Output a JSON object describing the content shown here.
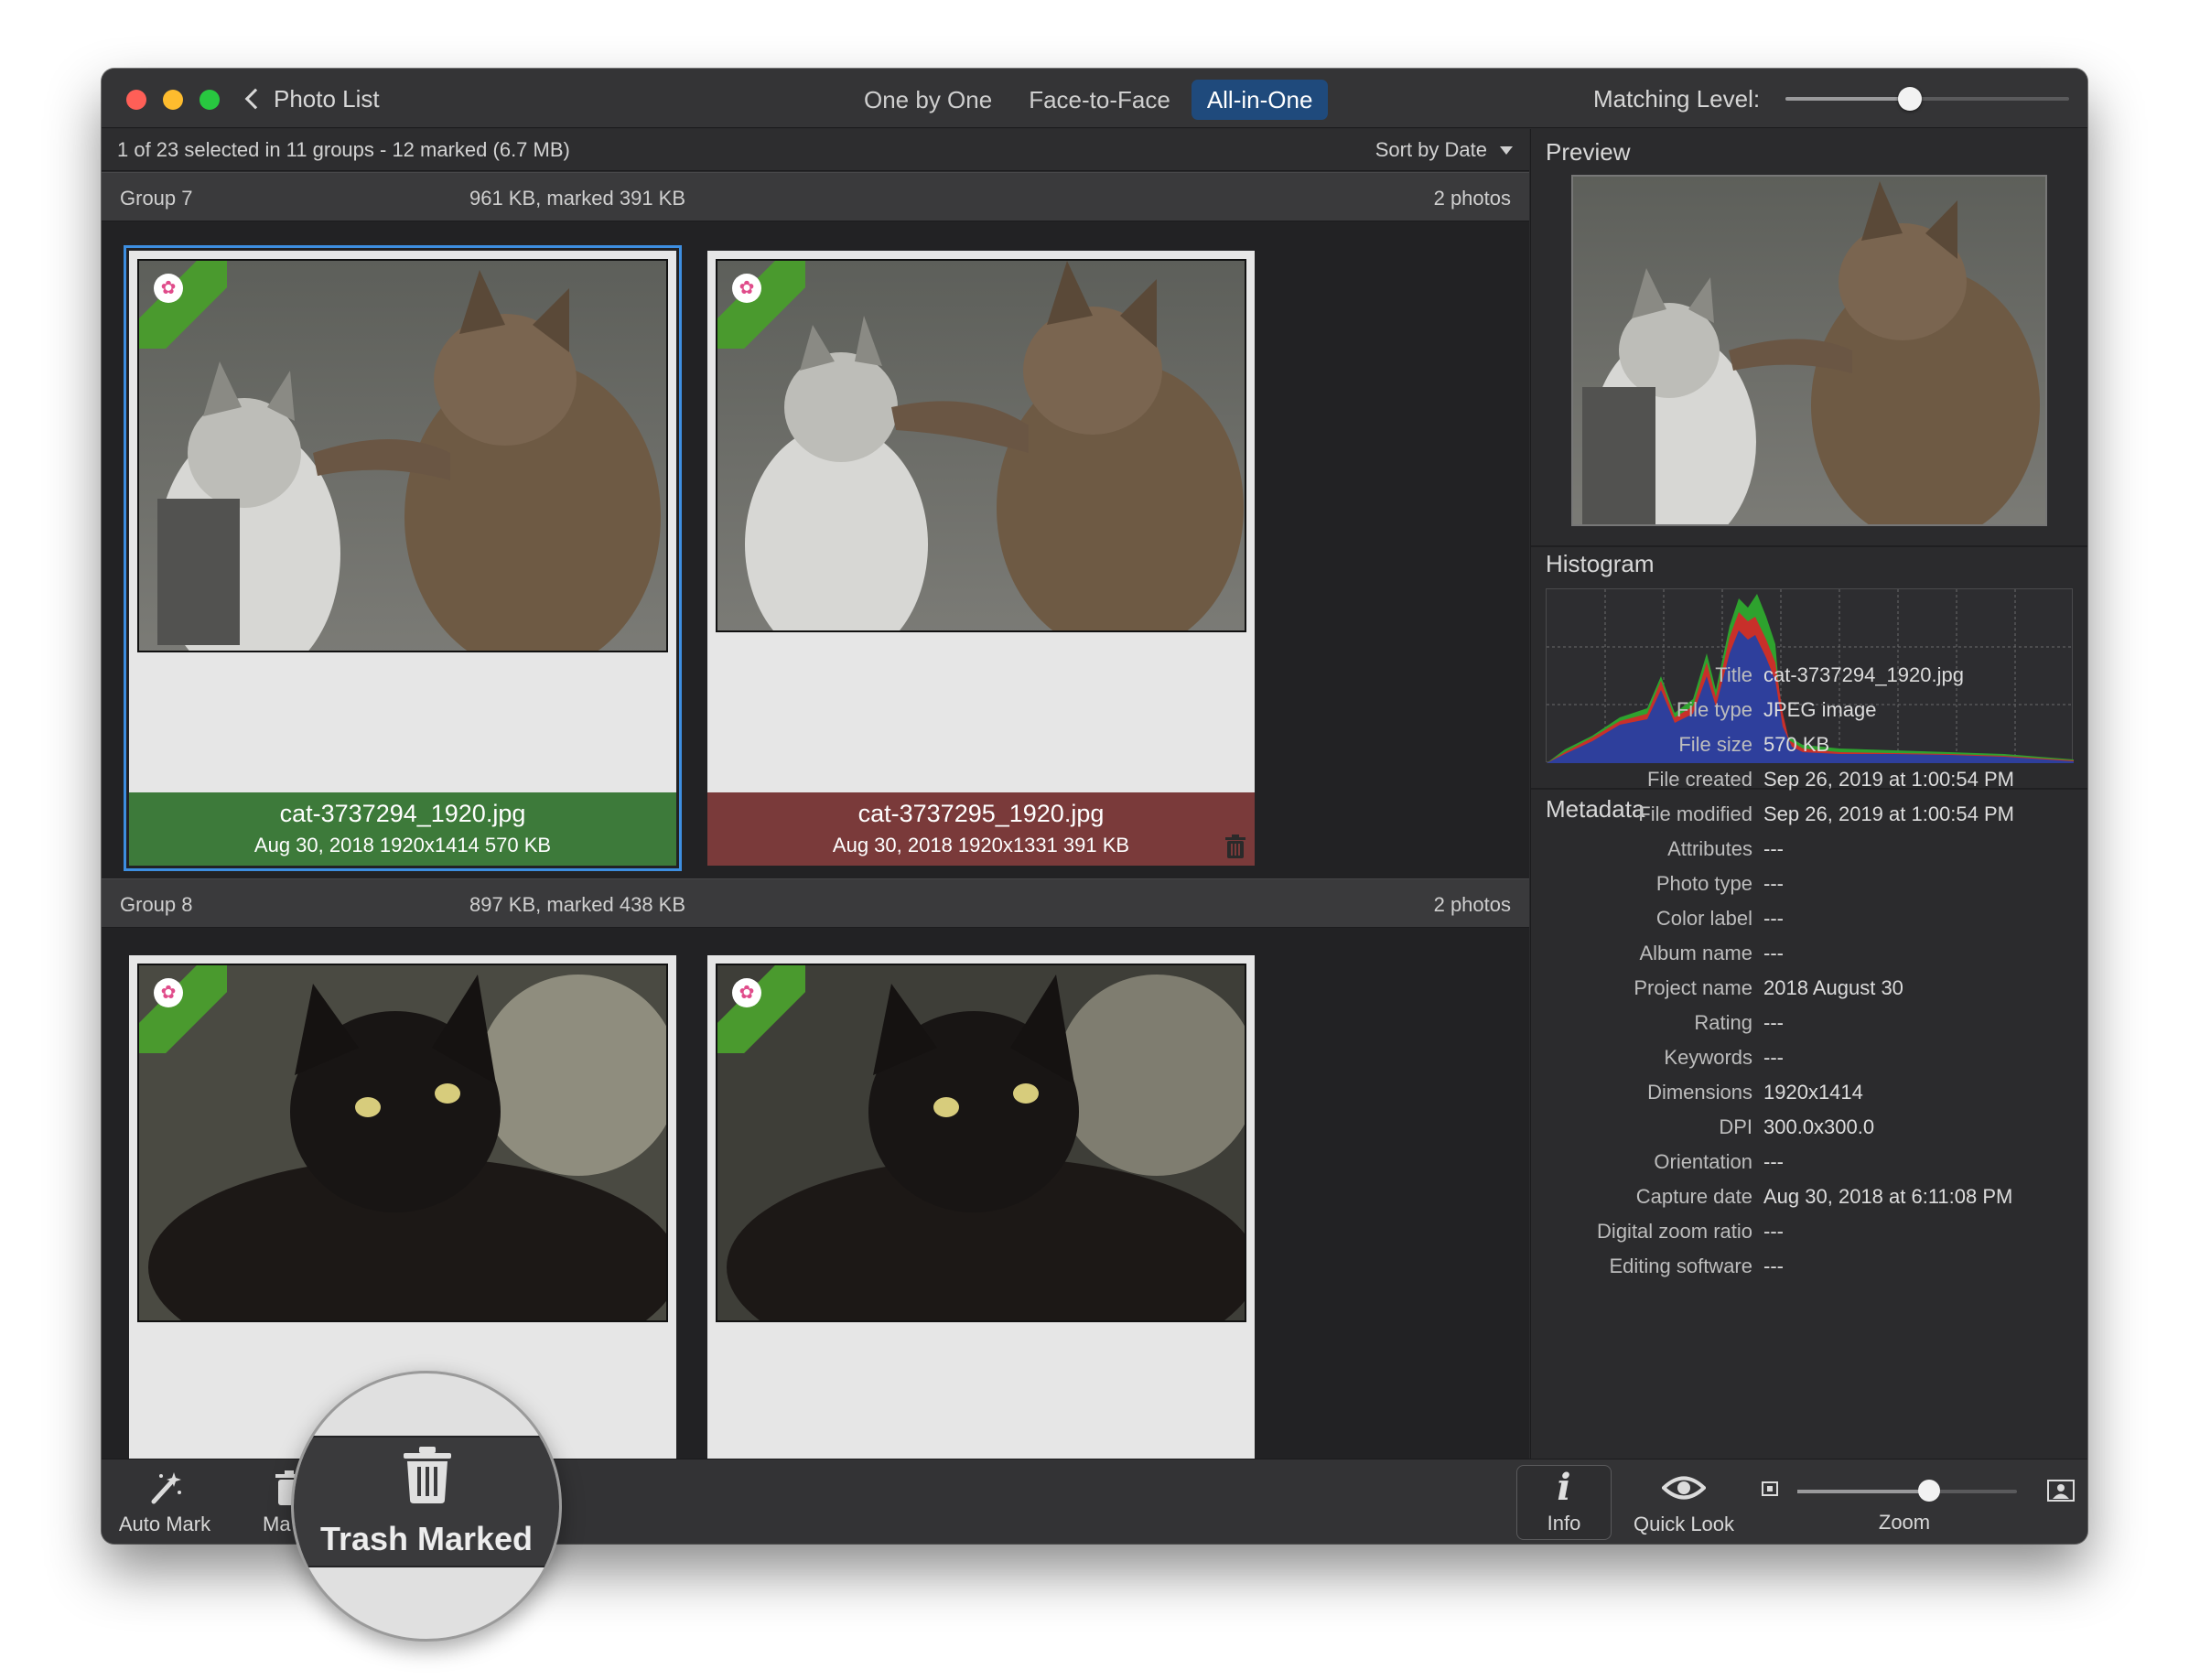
{
  "titlebar": {
    "back_label": "Photo List",
    "modes": [
      "One by One",
      "Face-to-Face",
      "All-in-One"
    ],
    "active_mode": "All-in-One",
    "matching_label": "Matching Level:",
    "matching_level": 0.44
  },
  "status": {
    "summary": "1 of 23 selected in 11 groups - 12 marked (6.7 MB)",
    "sort_label": "Sort by Date"
  },
  "groups": [
    {
      "name": "Group 7",
      "size": "961 KB, marked 391 KB",
      "count": "2 photos",
      "photos": [
        {
          "filename": "cat-3737294_1920.jpg",
          "meta": "Aug 30, 2018  1920x1414  570 KB",
          "status": "keep",
          "selected": true
        },
        {
          "filename": "cat-3737295_1920.jpg",
          "meta": "Aug 30, 2018  1920x1331  391 KB",
          "status": "marked",
          "selected": false
        }
      ]
    },
    {
      "name": "Group 8",
      "size": "897 KB, marked 438 KB",
      "count": "2 photos",
      "photos": [
        {
          "filename": "",
          "meta": "",
          "status": "none",
          "selected": false
        },
        {
          "filename": "",
          "meta": "",
          "status": "none",
          "selected": false
        }
      ]
    }
  ],
  "panel": {
    "preview_title": "Preview",
    "histogram_title": "Histogram",
    "metadata_title": "Metadata",
    "metadata": [
      {
        "key": "Title",
        "value": "cat-3737294_1920.jpg"
      },
      {
        "key": "File type",
        "value": "JPEG image"
      },
      {
        "key": "File size",
        "value": "570 KB"
      },
      {
        "key": "File created",
        "value": "Sep 26, 2019 at 1:00:54 PM"
      },
      {
        "key": "File modified",
        "value": "Sep 26, 2019 at 1:00:54 PM"
      },
      {
        "key": "Attributes",
        "value": "---"
      },
      {
        "key": "Photo type",
        "value": "---"
      },
      {
        "key": "Color label",
        "value": "---"
      },
      {
        "key": "Album name",
        "value": "---"
      },
      {
        "key": "Project name",
        "value": "2018 August 30"
      },
      {
        "key": "Rating",
        "value": "---"
      },
      {
        "key": "Keywords",
        "value": "---"
      },
      {
        "key": "Dimensions",
        "value": "1920x1414"
      },
      {
        "key": "DPI",
        "value": "300.0x300.0"
      },
      {
        "key": "Orientation",
        "value": "---"
      },
      {
        "key": "Capture date",
        "value": "Aug 30, 2018 at 6:11:08 PM"
      },
      {
        "key": "Digital zoom ratio",
        "value": "---"
      },
      {
        "key": "Editing software",
        "value": "---"
      }
    ]
  },
  "toolbar": {
    "auto_mark": "Auto Mark",
    "trash_partial": "Ma",
    "info": "Info",
    "quick_look": "Quick Look",
    "zoom": "Zoom",
    "zoom_level": 0.6
  },
  "magnifier": {
    "label": "Trash Marked"
  },
  "colors": {
    "accent": "#1f4a7c",
    "keep": "#3d7a3a",
    "marked": "#7a3a3a",
    "selection": "#3d8ee0"
  }
}
